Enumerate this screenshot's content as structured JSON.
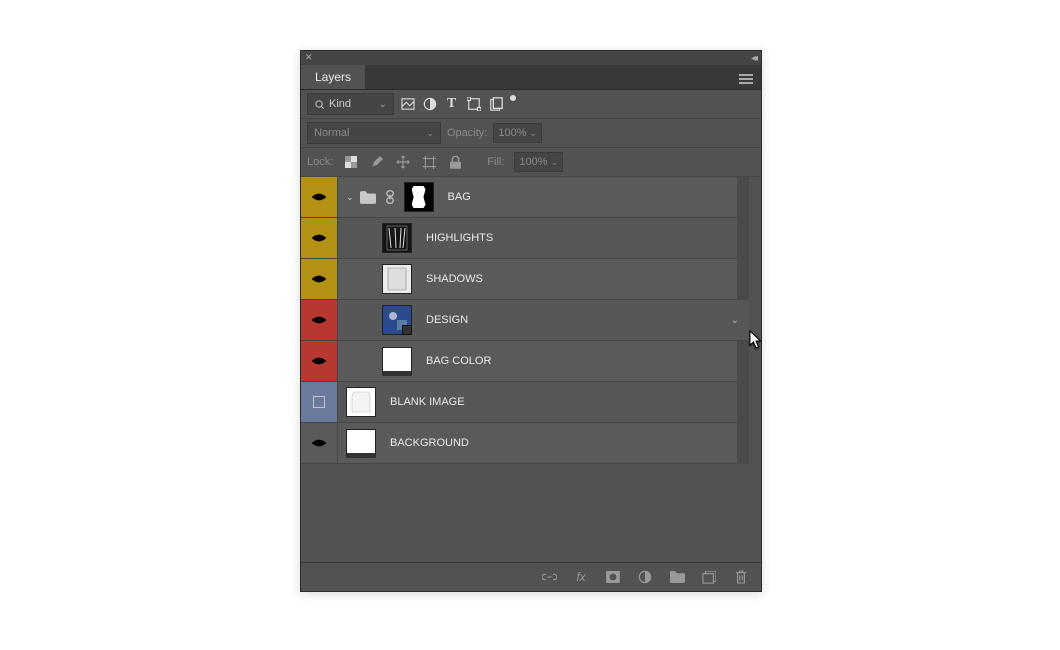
{
  "panel": {
    "title": "Layers"
  },
  "filter": {
    "kind_label": "Kind",
    "icons": [
      "pixel",
      "adjust",
      "type",
      "shape",
      "smart"
    ]
  },
  "blend": {
    "mode": "Normal",
    "opacity_label": "Opacity:",
    "opacity_value": "100%"
  },
  "lock": {
    "label": "Lock:",
    "fill_label": "Fill:",
    "fill_value": "100%"
  },
  "layers": [
    {
      "name": "BAG",
      "color": "gold",
      "visible": true,
      "type": "group",
      "expanded": true,
      "linked": true,
      "mask": true,
      "indent": 0
    },
    {
      "name": "HIGHLIGHTS",
      "color": "gold",
      "visible": true,
      "type": "pixel",
      "thumb": "dark",
      "indent": 1
    },
    {
      "name": "SHADOWS",
      "color": "gold",
      "visible": true,
      "type": "pixel",
      "thumb": "gray",
      "indent": 1
    },
    {
      "name": "DESIGN",
      "color": "red",
      "visible": true,
      "type": "smart",
      "thumb": "blue",
      "indent": 1,
      "selected": true
    },
    {
      "name": "BAG COLOR",
      "color": "red",
      "visible": true,
      "type": "pixel",
      "thumb": "white",
      "indent": 1
    },
    {
      "name": "BLANK IMAGE",
      "color": "blue",
      "visible": false,
      "type": "pixel",
      "thumb": "white",
      "indent": 0
    },
    {
      "name": "BACKGROUND",
      "color": "gray",
      "visible": true,
      "type": "pixel",
      "thumb": "white",
      "indent": 0
    }
  ],
  "footer_icons": [
    "link",
    "fx",
    "mask",
    "adjust",
    "group",
    "new",
    "trash"
  ]
}
